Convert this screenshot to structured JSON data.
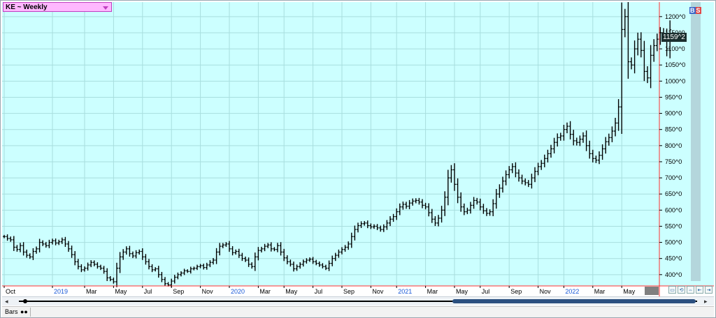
{
  "symbol_label": "KE ~ Weekly",
  "badge": {
    "b": "B",
    "s": "S"
  },
  "price_label": "1159^2",
  "bottom": {
    "bars_label": "Bars"
  },
  "nav": {
    "left_arrow": "◂",
    "right_arrow": "▸"
  },
  "colors": {
    "plot_bg": "#ccffff",
    "grid": "#a8dede",
    "bar": "#000000",
    "cursor_line": "#ff3030",
    "year_label": "#1a5ad8",
    "month_label": "#000000"
  },
  "chart_data": {
    "type": "ohlc",
    "title": "KE ~ Weekly",
    "y_ticks": [
      "1200^0",
      "1150^0",
      "1100^0",
      "1050^0",
      "1000^0",
      "950^0",
      "900^0",
      "850^0",
      "800^0",
      "750^0",
      "700^0",
      "650^0",
      "600^0",
      "550^0",
      "500^0",
      "450^0",
      "400^0"
    ],
    "ylim": [
      365,
      1245
    ],
    "x_labels": [
      {
        "text": "Oct",
        "year": false
      },
      {
        "text": "2019",
        "year": true
      },
      {
        "text": "Mar",
        "year": false
      },
      {
        "text": "May",
        "year": false
      },
      {
        "text": "Jul",
        "year": false
      },
      {
        "text": "Sep",
        "year": false
      },
      {
        "text": "Nov",
        "year": false
      },
      {
        "text": "2020",
        "year": true
      },
      {
        "text": "Mar",
        "year": false
      },
      {
        "text": "May",
        "year": false
      },
      {
        "text": "Jul",
        "year": false
      },
      {
        "text": "Sep",
        "year": false
      },
      {
        "text": "Nov",
        "year": false
      },
      {
        "text": "2021",
        "year": true
      },
      {
        "text": "Mar",
        "year": false
      },
      {
        "text": "May",
        "year": false
      },
      {
        "text": "Jul",
        "year": false
      },
      {
        "text": "Sep",
        "year": false
      },
      {
        "text": "Nov",
        "year": false
      },
      {
        "text": "2022",
        "year": true
      },
      {
        "text": "Mar",
        "year": false
      },
      {
        "text": "May",
        "year": false
      }
    ],
    "x_label_weeks": [
      0,
      15,
      25,
      34,
      43,
      52,
      61,
      70,
      79,
      87,
      96,
      105,
      114,
      122,
      131,
      140,
      148,
      157,
      166,
      174,
      183,
      192
    ],
    "last_price": "1159^2",
    "cursor_week": 196,
    "closes": [
      518,
      512,
      508,
      485,
      478,
      490,
      470,
      460,
      455,
      472,
      480,
      500,
      495,
      490,
      500,
      505,
      498,
      502,
      508,
      495,
      480,
      462,
      440,
      425,
      415,
      420,
      430,
      438,
      432,
      425,
      420,
      410,
      390,
      385,
      378,
      420,
      455,
      470,
      480,
      465,
      458,
      468,
      472,
      455,
      440,
      425,
      415,
      418,
      400,
      385,
      372,
      368,
      380,
      392,
      400,
      405,
      412,
      410,
      418,
      420,
      425,
      428,
      422,
      430,
      438,
      445,
      470,
      488,
      492,
      495,
      480,
      468,
      472,
      460,
      450,
      445,
      432,
      425,
      455,
      475,
      480,
      488,
      492,
      480,
      478,
      490,
      470,
      452,
      440,
      432,
      418,
      425,
      432,
      440,
      445,
      448,
      440,
      435,
      430,
      425,
      420,
      435,
      450,
      460,
      470,
      478,
      485,
      495,
      518,
      540,
      552,
      558,
      560,
      552,
      548,
      550,
      545,
      540,
      548,
      560,
      572,
      580,
      595,
      610,
      618,
      612,
      622,
      628,
      630,
      625,
      615,
      610,
      592,
      572,
      560,
      575,
      600,
      640,
      700,
      725,
      680,
      640,
      610,
      595,
      600,
      615,
      630,
      625,
      610,
      598,
      590,
      595,
      620,
      650,
      668,
      690,
      710,
      725,
      735,
      715,
      700,
      690,
      685,
      680,
      700,
      720,
      735,
      745,
      760,
      775,
      790,
      810,
      825,
      830,
      850,
      860,
      835,
      815,
      810,
      820,
      830,
      800,
      775,
      760,
      755,
      770,
      790,
      812,
      825,
      845,
      870,
      920,
      1160,
      1200,
      1060,
      1050,
      1100,
      1130,
      1095,
      1030,
      1010,
      1080,
      1110,
      1130,
      1150,
      1140,
      1100,
      1159
    ]
  }
}
